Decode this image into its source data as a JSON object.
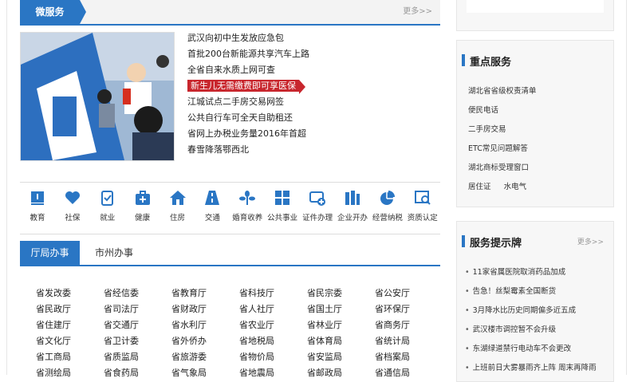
{
  "micro_service": {
    "title": "微服务",
    "more": "更多>>",
    "news": [
      "武汉向初中生发放应急包",
      "首批200台新能源共享汽车上路",
      "全省自来水质上网可查",
      "新生儿无需缴费即可享医保",
      "江城试点二手房交易网签",
      "公共自行车可全天自助租还",
      "省网上办税业务量2016年首超",
      "春雪降落鄂西北"
    ]
  },
  "icons": [
    {
      "label": "教育",
      "icon": "education-icon"
    },
    {
      "label": "社保",
      "icon": "heart-hands-icon"
    },
    {
      "label": "就业",
      "icon": "clipboard-check-icon"
    },
    {
      "label": "健康",
      "icon": "medical-kit-icon"
    },
    {
      "label": "住房",
      "icon": "house-icon"
    },
    {
      "label": "交通",
      "icon": "road-icon"
    },
    {
      "label": "婚育收养",
      "icon": "plant-icon"
    },
    {
      "label": "公共事业",
      "icon": "grid-icon"
    },
    {
      "label": "证件办理",
      "icon": "id-card-plus-icon"
    },
    {
      "label": "企业开办",
      "icon": "building-icon"
    },
    {
      "label": "经营纳税",
      "icon": "pie-chart-icon"
    },
    {
      "label": "资质认定",
      "icon": "certificate-search-icon"
    }
  ],
  "bureau_tabs": {
    "active": "厅局办事",
    "inactive": "市州办事"
  },
  "departments": [
    "省发改委",
    "省经信委",
    "省教育厅",
    "省科技厅",
    "省民宗委",
    "省公安厅",
    "省民政厅",
    "省司法厅",
    "省财政厅",
    "省人社厅",
    "省国土厅",
    "省环保厅",
    "省住建厅",
    "省交通厅",
    "省水利厅",
    "省农业厅",
    "省林业厅",
    "省商务厅",
    "省文化厅",
    "省卫计委",
    "省外侨办",
    "省地税局",
    "省体育局",
    "省统计局",
    "省工商局",
    "省质监局",
    "省旅游委",
    "省物价局",
    "省安监局",
    "省档案局",
    "省测绘局",
    "省食药局",
    "省气象局",
    "省地震局",
    "省邮政局",
    "省通信局"
  ],
  "key_services": {
    "title": "重点服务",
    "items": [
      "湖北省省级权责清单",
      "便民电话",
      "二手房交易",
      "ETC常见问题解答",
      "湖北商标受理窗口"
    ],
    "last_row": [
      "居住证",
      "水电气"
    ]
  },
  "service_tips": {
    "title": "服务提示牌",
    "more": "更多>>",
    "items": [
      "11家省属医院取消药品加成",
      "告急！丝梨霉素全国断货",
      "3月降水比历史同期偏多近五成",
      "武汉楼市调控暂不会升级",
      "东湖绿道禁行电动车不会更改",
      "上班前日大雾暴雨齐上阵 周末再降雨"
    ]
  },
  "colors": {
    "accent": "#2a76c4",
    "highlight": "#c8262d"
  }
}
